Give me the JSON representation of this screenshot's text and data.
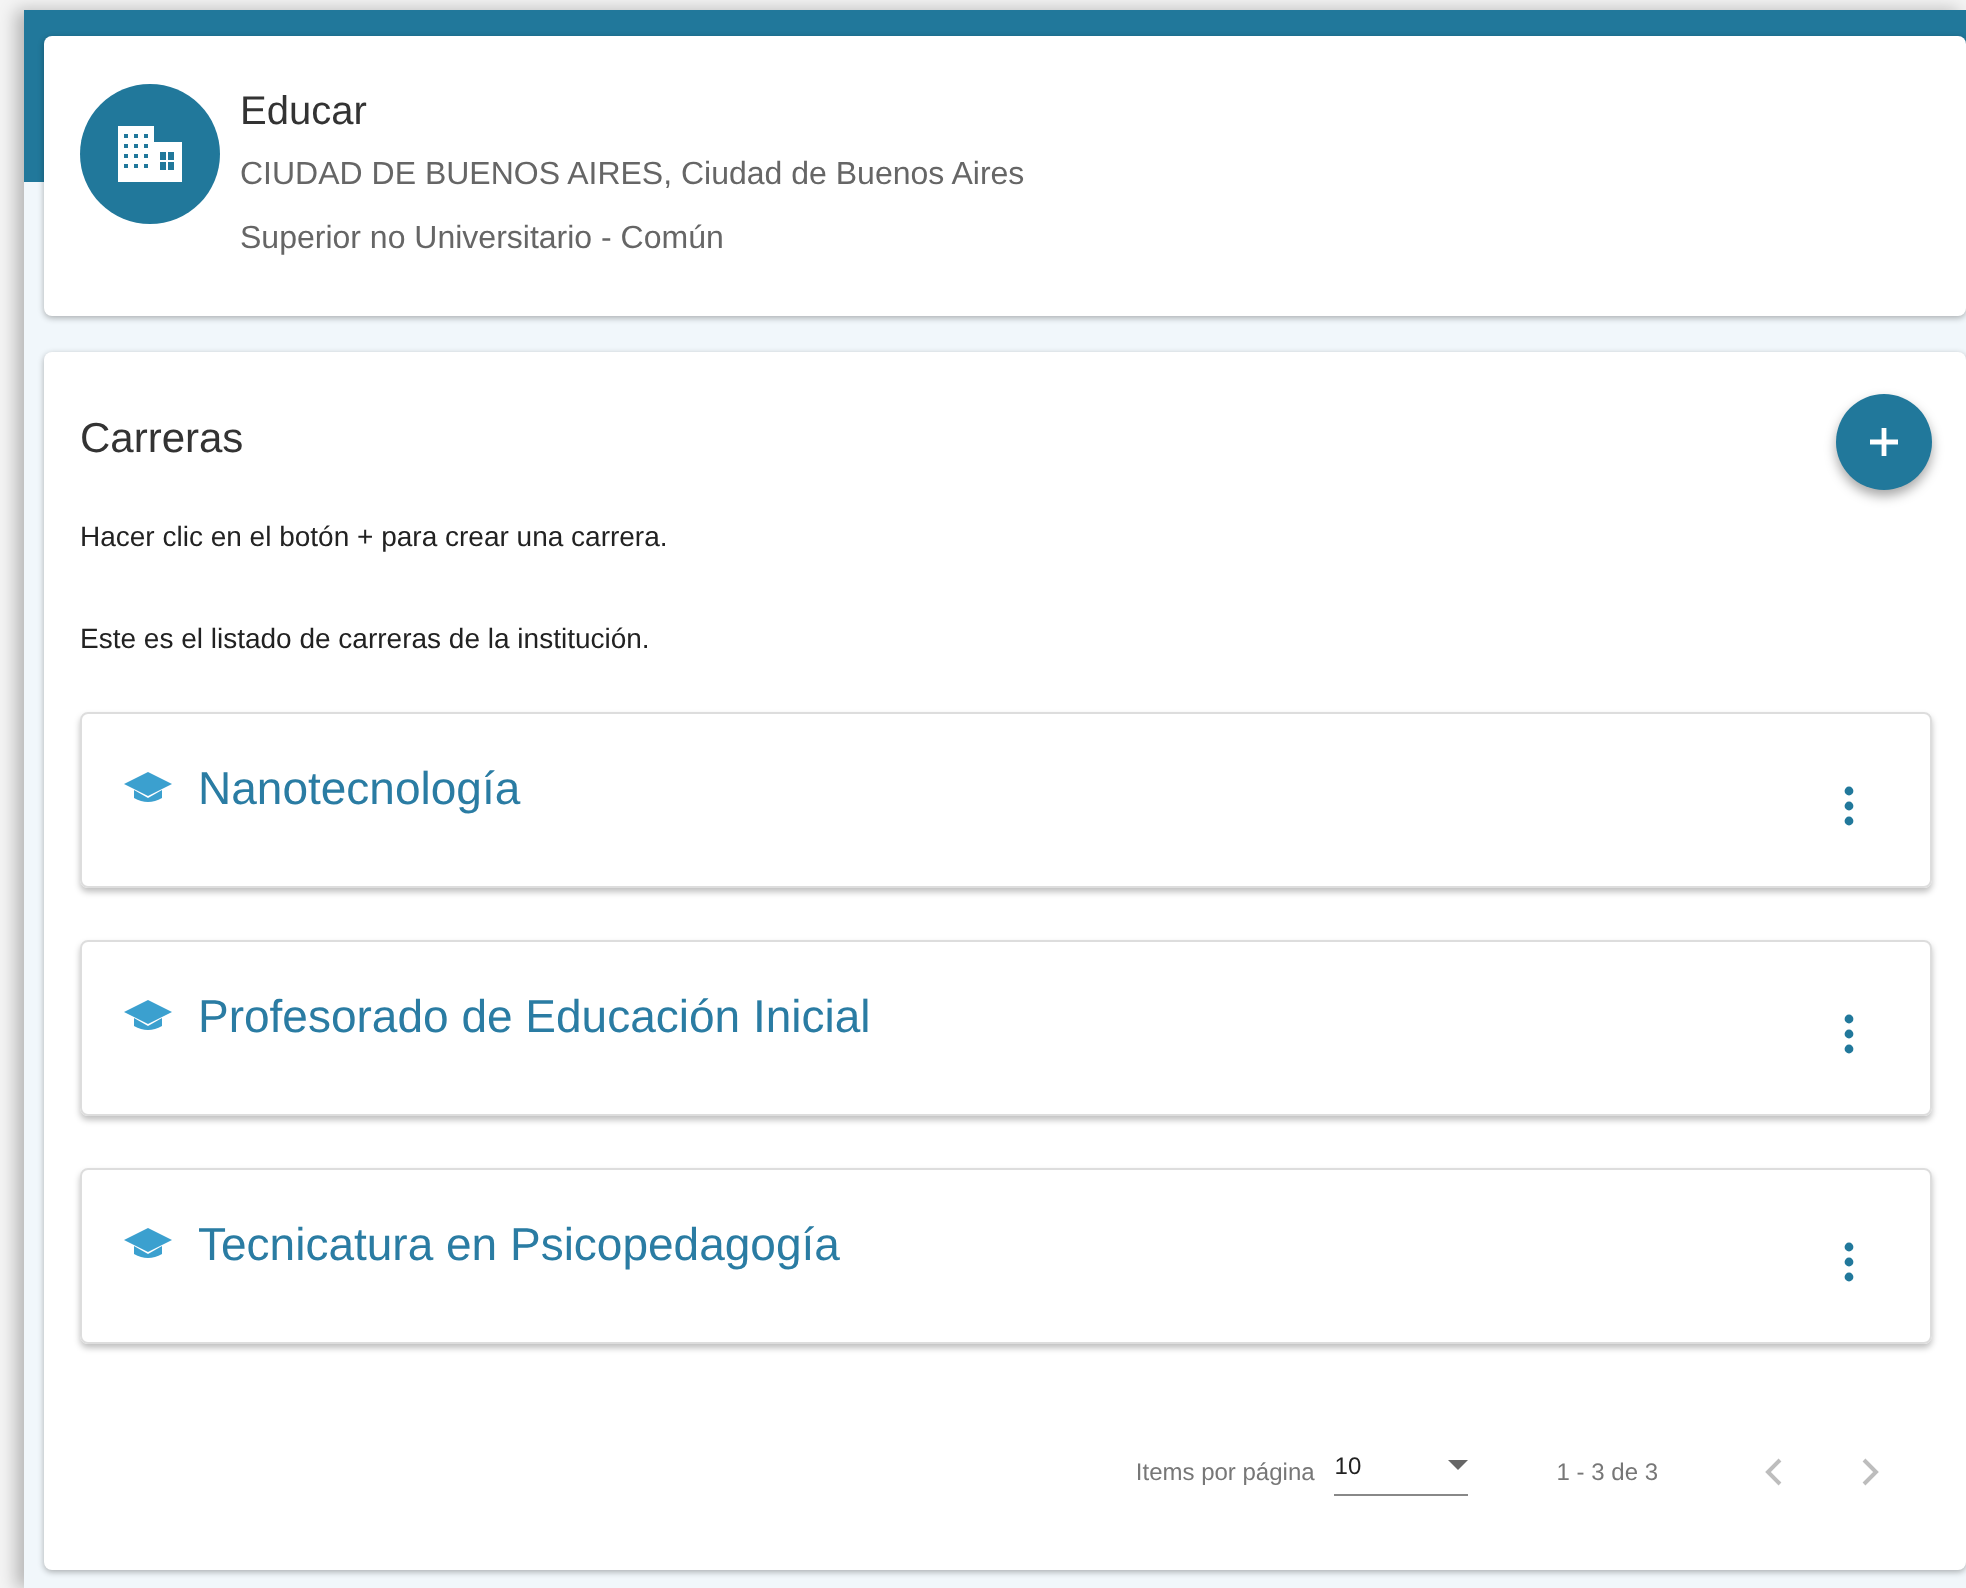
{
  "institution": {
    "name": "Educar",
    "location": "CIUDAD DE BUENOS AIRES, Ciudad de Buenos Aires",
    "level": "Superior no Universitario - Común"
  },
  "section": {
    "title": "Carreras",
    "hints": [
      "Hacer clic en el botón + para crear una carrera.",
      "Este es el listado de carreras de la institución."
    ]
  },
  "careers": [
    {
      "name": "Nanotecnología"
    },
    {
      "name": "Profesorado de Educación Inicial"
    },
    {
      "name": "Tecnicatura en Psicopedagogía"
    }
  ],
  "paginator": {
    "label": "Items por página",
    "page_size": "10",
    "range": "1 - 3 de 3",
    "prev_disabled": true,
    "next_disabled": true
  }
}
